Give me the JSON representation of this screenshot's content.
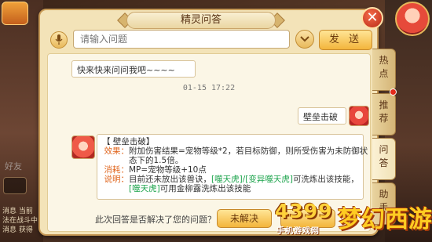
{
  "dialog": {
    "title": "精灵问答",
    "close_label": "✕"
  },
  "input": {
    "placeholder": "请输入问题",
    "send_label": "发 送"
  },
  "chat": {
    "user_message_1": "快来快来问问我吧~~~~",
    "timestamp": "01-15 17:22",
    "user_message_2": "壁垒击破",
    "answer": {
      "title": "【 壁垒击破】",
      "effect_label": "效果：",
      "effect_text_1": "附加伤害结果=宠物等级*2，若目标防御，则所受伤害为未防御状",
      "effect_text_2": "态下的1.5倍。",
      "cost_label": "消耗：",
      "cost_text": "MP=宠物等级+10点",
      "note_label": "说明：",
      "note_text_1": "目前还未放出该兽诀，",
      "note_green_1": "[噬天虎]/[变异噬天虎]",
      "note_text_2": "可洗炼出该技能，",
      "note_green_2": "[噬天虎]",
      "note_text_3": "可用金柳露洗炼出该技能"
    }
  },
  "feedback": {
    "question": "此次回答是否解决了您的问题？",
    "unresolved_label": "未解决"
  },
  "side_tabs": [
    {
      "label": "热\n点"
    },
    {
      "label": "推\n荐"
    },
    {
      "label": "问\n答"
    },
    {
      "label": "助\n手"
    }
  ],
  "background": {
    "friend_label": "好友",
    "msg_line_1": "消息 当前",
    "msg_line_2": "法在战斗中",
    "msg_line_3": "消息 获得"
  },
  "watermark": {
    "brand_number": "4399",
    "brand_sub": "手机游戏网",
    "game_name": "梦幻西游"
  }
}
